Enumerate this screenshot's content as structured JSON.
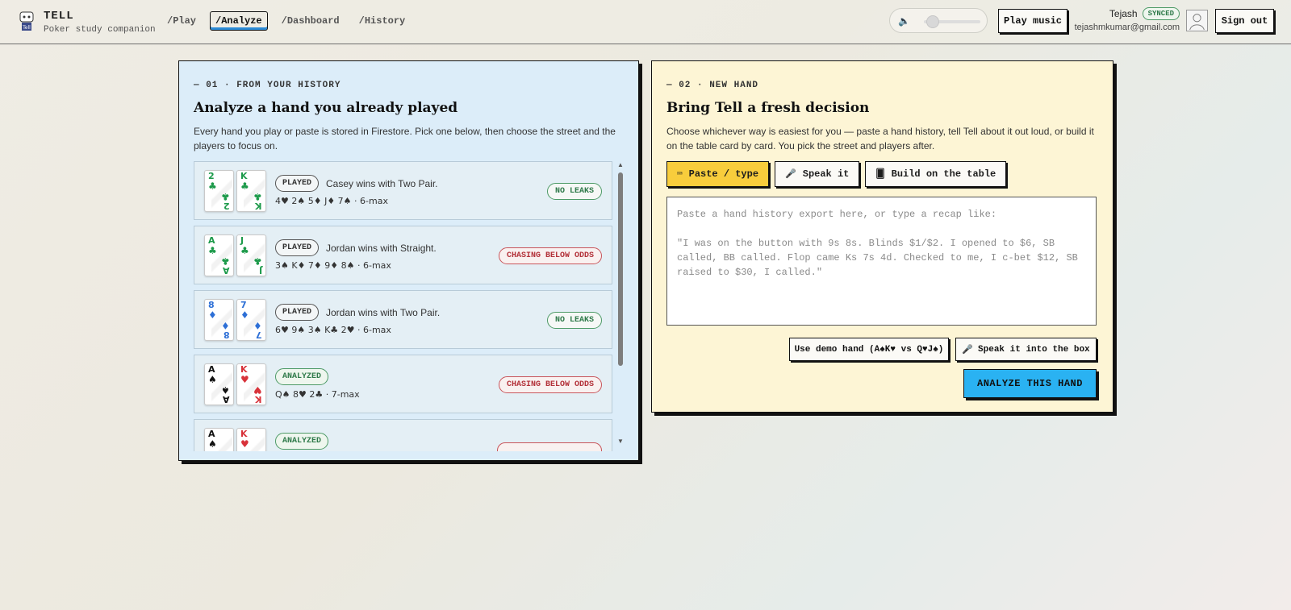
{
  "app": {
    "name": "TELL",
    "tagline": "Poker study companion",
    "logo_text": "Tell"
  },
  "nav": [
    {
      "label": "/Play",
      "active": false
    },
    {
      "label": "/Analyze",
      "active": true
    },
    {
      "label": "/Dashboard",
      "active": false
    },
    {
      "label": "/History",
      "active": false
    }
  ],
  "header": {
    "volume_icon": "speaker-icon",
    "volume_level": 0.1,
    "play_music_label": "Play music",
    "user_name": "Tejash",
    "sync_badge": "SYNCED",
    "user_email": "tejashmkumar@gmail.com",
    "sign_out_label": "Sign out"
  },
  "history_panel": {
    "eyebrow": "— 01 · FROM YOUR HISTORY",
    "title": "Analyze a hand you already played",
    "description": "Every hand you play or paste is stored in Firestore. Pick one below, then choose the street and the players to focus on.",
    "hands": [
      {
        "cards": [
          {
            "rank": "2",
            "suit": "♣",
            "color": "#1c9a4a"
          },
          {
            "rank": "K",
            "suit": "♣",
            "color": "#1c9a4a"
          }
        ],
        "badge": "PLAYED",
        "summary": "Casey wins with Two Pair.",
        "board": "4♥ 2♠ 5♦ J♦ 7♠ · 6-max",
        "status": "NO LEAKS",
        "status_type": "ok"
      },
      {
        "cards": [
          {
            "rank": "A",
            "suit": "♣",
            "color": "#1c9a4a"
          },
          {
            "rank": "J",
            "suit": "♣",
            "color": "#1c9a4a"
          }
        ],
        "badge": "PLAYED",
        "summary": "Jordan wins with Straight.",
        "board": "3♠ K♦ 7♦ 9♦ 8♠ · 6-max",
        "status": "CHASING BELOW ODDS",
        "status_type": "bad"
      },
      {
        "cards": [
          {
            "rank": "8",
            "suit": "♦",
            "color": "#2d6fd6"
          },
          {
            "rank": "7",
            "suit": "♦",
            "color": "#2d6fd6"
          }
        ],
        "badge": "PLAYED",
        "summary": "Jordan wins with Two Pair.",
        "board": "6♥ 9♠ 3♠ K♣ 2♥ · 6-max",
        "status": "NO LEAKS",
        "status_type": "ok"
      },
      {
        "cards": [
          {
            "rank": "A",
            "suit": "♠",
            "color": "#111111"
          },
          {
            "rank": "K",
            "suit": "♥",
            "color": "#d8323a"
          }
        ],
        "badge": "ANALYZED",
        "summary": "",
        "board": "Q♠ 8♥ 2♣ · 7-max",
        "status": "CHASING BELOW ODDS",
        "status_type": "bad"
      },
      {
        "cards": [
          {
            "rank": "A",
            "suit": "♠",
            "color": "#111111"
          },
          {
            "rank": "K",
            "suit": "♥",
            "color": "#d8323a"
          }
        ],
        "badge": "ANALYZED",
        "summary": "",
        "board": "",
        "status": "",
        "status_type": "bad"
      }
    ]
  },
  "new_hand_panel": {
    "eyebrow": "— 02 · NEW HAND",
    "title": "Bring Tell a fresh decision",
    "description": "Choose whichever way is easiest for you — paste a hand history, tell Tell about it out loud, or build it on the table card by card. You pick the street and players after.",
    "tabs": [
      {
        "icon": "⌨",
        "icon_name": "keyboard-icon",
        "label": "Paste / type",
        "active": true
      },
      {
        "icon": "🎤",
        "icon_name": "microphone-icon",
        "label": "Speak it",
        "active": false
      },
      {
        "icon": "🂠",
        "icon_name": "card-icon",
        "label": "Build on the table",
        "active": false
      }
    ],
    "textarea_placeholder": "Paste a hand history export here, or type a recap like:\n\n\"I was on the button with 9s 8s. Blinds $1/$2. I opened to $6, SB called, BB called. Flop came Ks 7s 4d. Checked to me, I c-bet $12, SB raised to $30, I called.\"",
    "demo_button": "Use demo hand (A♠K♥ vs Q♥J♠)",
    "speak_box_button": "Speak it into the box",
    "speak_box_icon": "🎤",
    "analyze_button": "ANALYZE THIS HAND"
  },
  "colors": {
    "history_bg": "#dcedf9",
    "new_hand_bg": "#fdf5d5",
    "accent_yellow": "#f8cd3c",
    "accent_blue": "#2ab2f2",
    "ok_green": "#2f7a4a",
    "bad_red": "#b3323a"
  }
}
